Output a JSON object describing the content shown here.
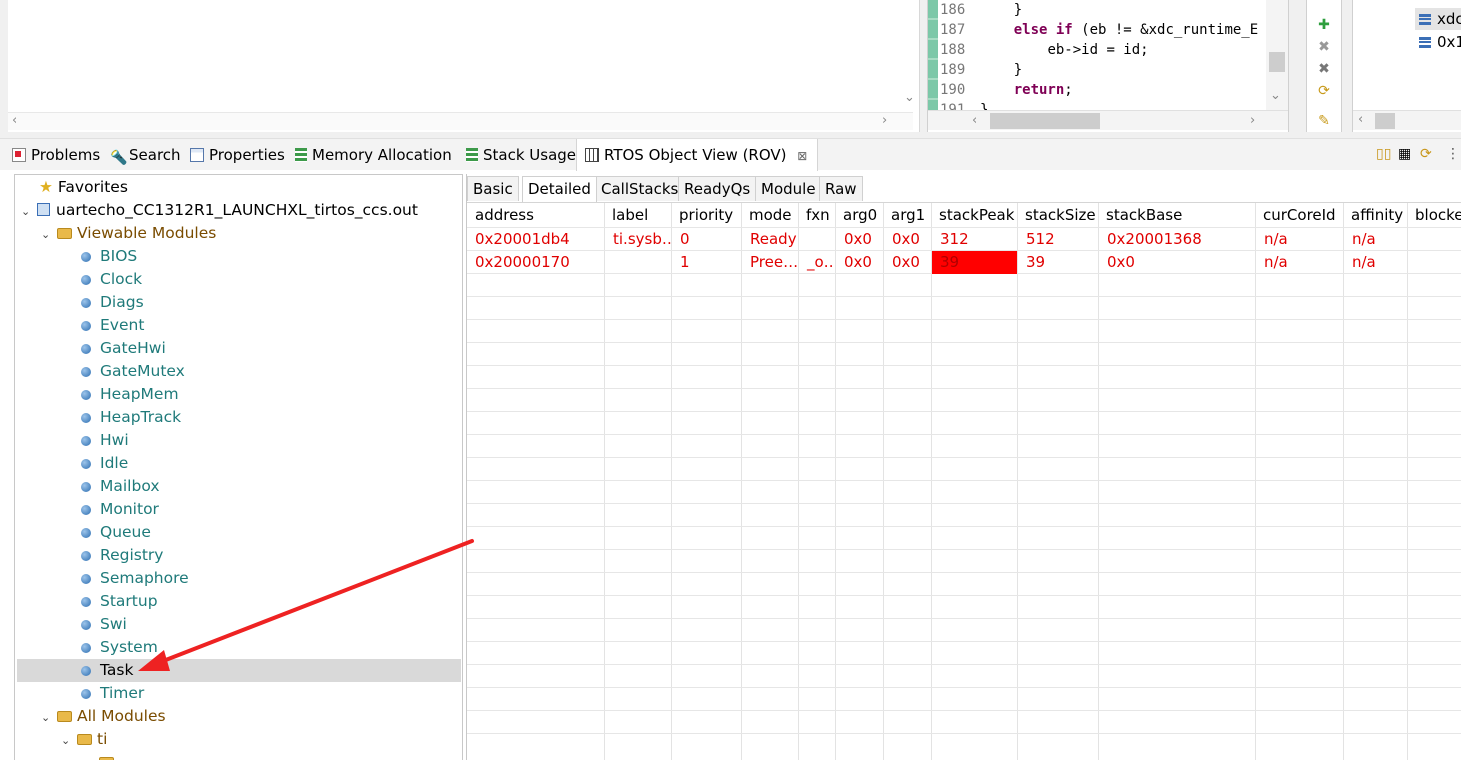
{
  "code": {
    "lines": [
      {
        "num": "186",
        "indent": "    ",
        "text": "}"
      },
      {
        "num": "187",
        "kw": "else if",
        "text": " (eb != &xdc_runtime_E"
      },
      {
        "num": "188",
        "indent": "        ",
        "text": "eb->id = id;"
      },
      {
        "num": "189",
        "indent": "    ",
        "text": "}"
      },
      {
        "num": "190",
        "kw": "return",
        "text": ";"
      },
      {
        "num": "191",
        "text": "}"
      }
    ]
  },
  "outline": {
    "items": [
      {
        "label": "xdc"
      },
      {
        "label": "0x1"
      }
    ]
  },
  "views": {
    "tabs": [
      {
        "label": "Problems",
        "icon": "problems-icon"
      },
      {
        "label": "Search",
        "icon": "search-icon"
      },
      {
        "label": "Properties",
        "icon": "properties-icon"
      },
      {
        "label": "Memory Allocation",
        "icon": "memory-icon"
      },
      {
        "label": "Stack Usage",
        "icon": "stack-icon"
      },
      {
        "label": "RTOS Object View (ROV)",
        "icon": "rov-icon",
        "active": true
      }
    ],
    "close_glyph": "⊠"
  },
  "tree": {
    "favorites": "Favorites",
    "root": "uartecho_CC1312R1_LAUNCHXL_tirtos_ccs.out",
    "viewable": "Viewable Modules",
    "modules": [
      "BIOS",
      "Clock",
      "Diags",
      "Event",
      "GateHwi",
      "GateMutex",
      "HeapMem",
      "HeapTrack",
      "Hwi",
      "Idle",
      "Mailbox",
      "Monitor",
      "Queue",
      "Registry",
      "Semaphore",
      "Startup",
      "Swi",
      "System",
      "Task",
      "Timer"
    ],
    "selected": "Task",
    "all_modules": "All Modules",
    "ti": "ti"
  },
  "subtabs": [
    "Basic",
    "Detailed",
    "CallStacks",
    "ReadyQs",
    "Module",
    "Raw"
  ],
  "active_subtab": "Detailed",
  "table": {
    "columns": [
      "address",
      "label",
      "priority",
      "mode",
      "fxn",
      "arg0",
      "arg1",
      "stackPeak",
      "stackSize",
      "stackBase",
      "curCoreId",
      "affinity",
      "blocke"
    ],
    "rows": [
      [
        "0x20001db4",
        "ti.sysb…",
        "0",
        "Ready",
        "",
        "0x0",
        "0x0",
        "312",
        "512",
        "0x20001368",
        "n/a",
        "n/a",
        ""
      ],
      [
        "0x20000170",
        "",
        "1",
        "Pree…",
        "_o…",
        "0x0",
        "0x0",
        "39",
        "39",
        "0x0",
        "n/a",
        "n/a",
        ""
      ]
    ],
    "highlight": {
      "row": 1,
      "col": 7,
      "color": "#ff0000"
    }
  },
  "colors": {
    "error_text": "#e00000",
    "annotation_arrow": "#ee2222"
  }
}
